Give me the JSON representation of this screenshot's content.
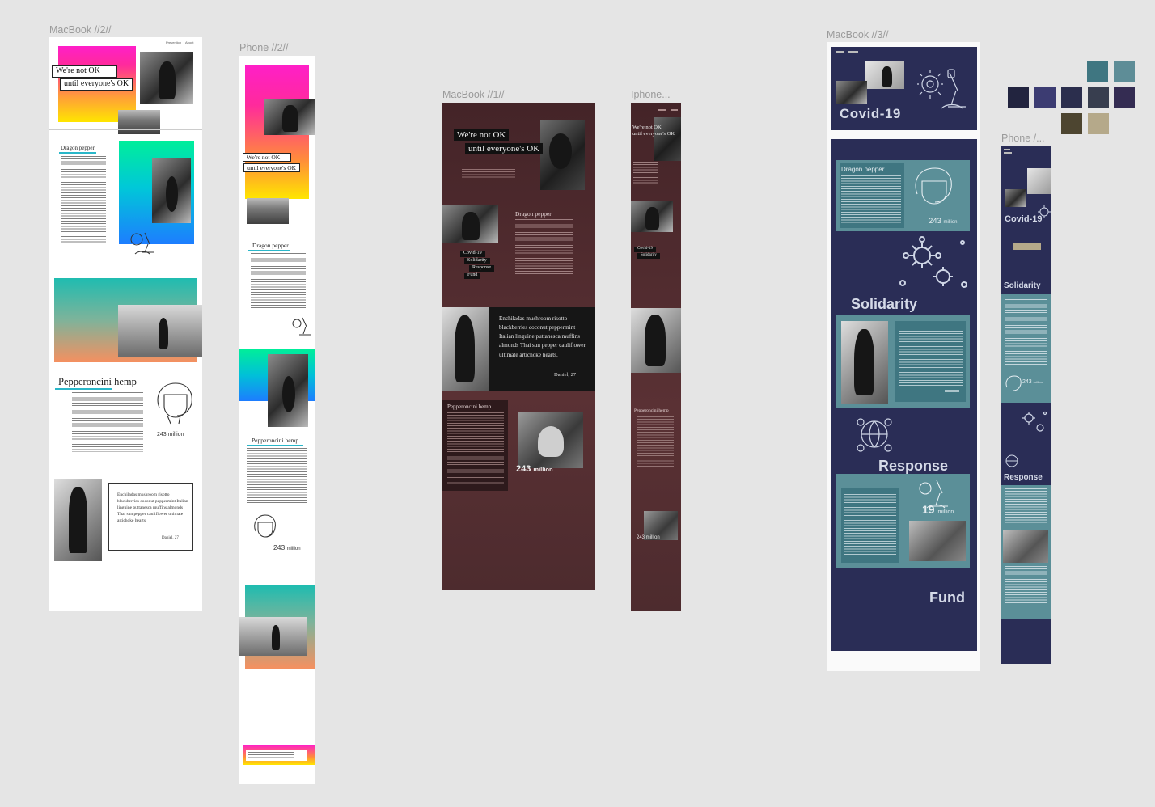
{
  "frames": {
    "macbook2": {
      "label": "MacBook //2//",
      "nav": [
        "Prevention",
        "About"
      ]
    },
    "phone2": {
      "label": "Phone  //2//"
    },
    "macbook1": {
      "label": "MacBook //1//"
    },
    "iphone": {
      "label": "Iphone..."
    },
    "macbook3": {
      "label": "MacBook //3//"
    },
    "phone3": {
      "label": "Phone /..."
    }
  },
  "content": {
    "hero_line1": "We're not OK",
    "hero_line2": "until everyone's OK",
    "section_dragon": "Dragon pepper",
    "section_pepperoncini": "Pepperoncini hemp",
    "stat_243": "243 million",
    "stat_243_num": "243",
    "stat_million": "million",
    "stat_19": "19",
    "quote": "Enchiladas mushroom risotto blackberries coconut peppermint Italian linguine puttanesca muffins almonds Thai sun pepper cauliflower ultimate artichoke hearts.",
    "quote_author": "Daniel, 27",
    "covid": "Covid-19",
    "solidarity": "Solidarity",
    "response": "Response",
    "fund": "Fund",
    "menu": [
      "Covid-19",
      "Solidarity",
      "Response",
      "Fund"
    ]
  },
  "palette": [
    "#3f7681",
    "#5e8d97",
    "#22243f",
    "#3c3c72",
    "#2b2e4d",
    "#383e4f",
    "#342c52",
    "#4d4530",
    "#b5a98a"
  ]
}
